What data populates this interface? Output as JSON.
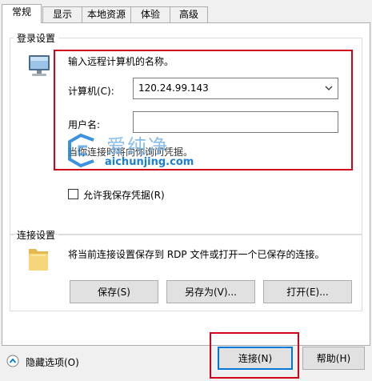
{
  "tabs": [
    {
      "label": "常规"
    },
    {
      "label": "显示"
    },
    {
      "label": "本地资源"
    },
    {
      "label": "体验"
    },
    {
      "label": "高级"
    }
  ],
  "login": {
    "group_title": "登录设置",
    "prompt": "输入远程计算机的名称。",
    "computer_label": "计算机(C):",
    "computer_value": "120.24.99.143",
    "user_label": "用户名:",
    "user_value": "",
    "hint": "当你连接时将向你询问凭据。",
    "save_credentials_label": "允许我保存凭据(R)",
    "save_credentials_checked": false
  },
  "watermark": {
    "text_cn": "爱纯净",
    "text_en": "aichunjing.com"
  },
  "connection": {
    "group_title": "连接设置",
    "description": "将当前连接设置保存到 RDP 文件或打开一个已保存的连接。",
    "save_label": "保存(S)",
    "save_as_label": "另存为(V)...",
    "open_label": "打开(E)..."
  },
  "footer": {
    "hide_options_label": "隐藏选项(O)",
    "connect_label": "连接(N)",
    "help_label": "帮助(H)"
  },
  "colors": {
    "highlight_border": "#d0021b",
    "accent": "#0078d7"
  }
}
